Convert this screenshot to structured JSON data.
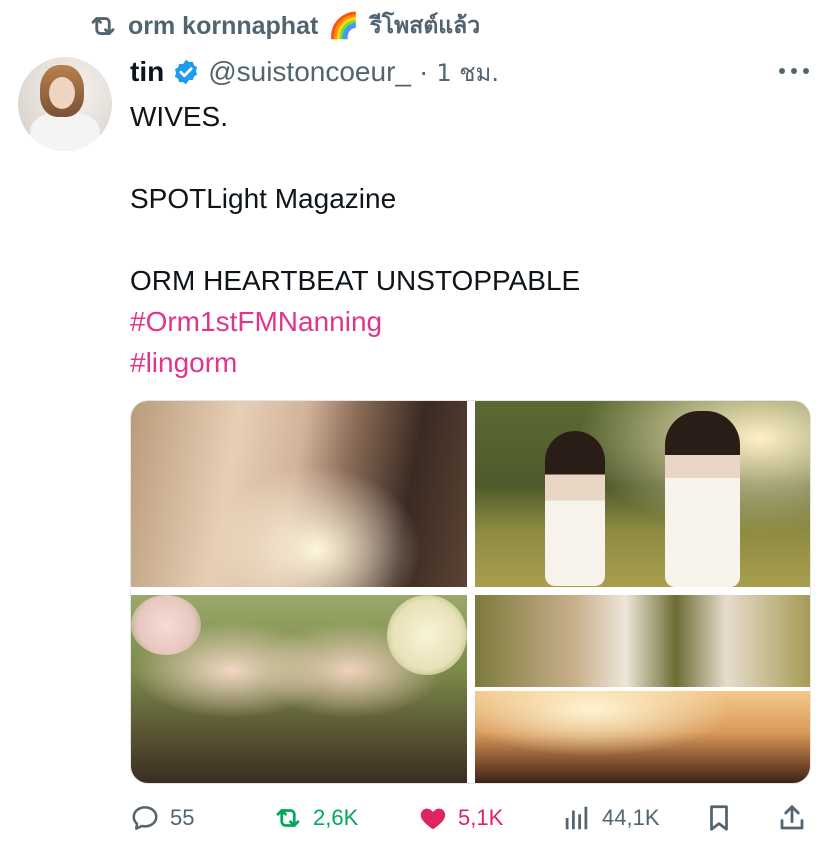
{
  "repost": {
    "icon": "repost-icon",
    "user": "orm kornnaphat",
    "emoji": "🌈",
    "suffix": "รีโพสต์แล้ว"
  },
  "tweet": {
    "display_name": "tin",
    "verified": true,
    "handle": "@suistoncoeur_",
    "separator": "·",
    "time": "1 ชม.",
    "lines": {
      "l1": "WIVES.",
      "l2": "SPOTLight Magazine",
      "l3": "ORM HEARTBEAT UNSTOPPABLE"
    },
    "hashtags": [
      "#Orm1stFMNanning",
      "#lingorm"
    ],
    "hashtag_color": "#e0358a",
    "photo_count": 5
  },
  "actions": {
    "replies": "55",
    "reposts": "2,6K",
    "likes": "5,1K",
    "views": "44,1K",
    "repost_color": "#00a85a",
    "like_color": "#e0245e"
  }
}
